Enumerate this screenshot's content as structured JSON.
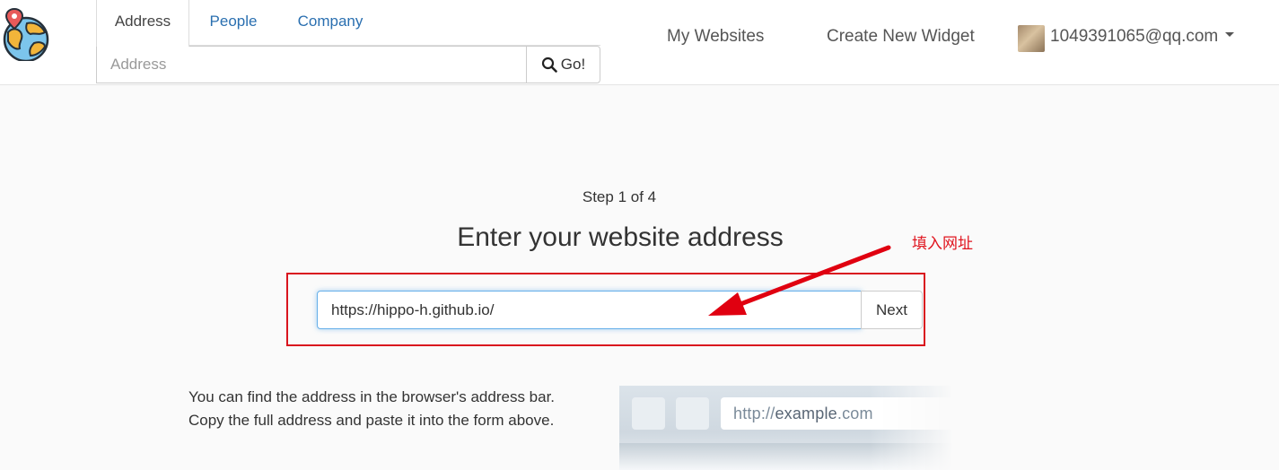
{
  "header": {
    "tabs": [
      {
        "label": "Address",
        "active": true
      },
      {
        "label": "People",
        "active": false
      },
      {
        "label": "Company",
        "active": false
      }
    ],
    "search": {
      "placeholder": "Address",
      "value": ""
    },
    "go_label": "Go!",
    "nav": [
      {
        "label": "My Websites"
      },
      {
        "label": "Create New Widget"
      }
    ],
    "user": {
      "email": "1049391065@qq.com"
    }
  },
  "main": {
    "step": "Step 1 of 4",
    "title": "Enter your website address",
    "url_input": {
      "value": "https://hippo-h.github.io/"
    },
    "next_label": "Next",
    "annotation": "填入网址",
    "help": {
      "line1": "You can find the address in the browser's address bar.",
      "line2": "Copy the full address and paste it into the form above."
    },
    "illustration": {
      "url_prefix": "http://",
      "url_host": "example",
      "url_suffix": ".com"
    }
  },
  "colors": {
    "link": "#2a6fb0",
    "annotation_red": "#e0141e",
    "focus_blue": "#66afe9"
  }
}
